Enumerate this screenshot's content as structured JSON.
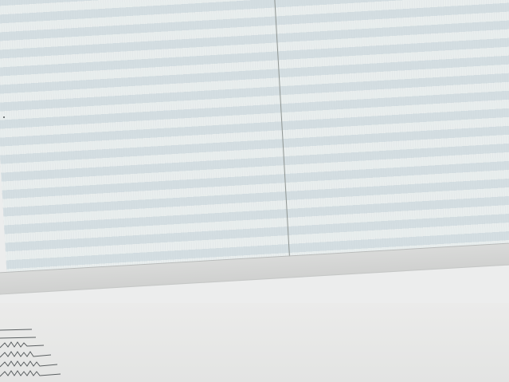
{
  "app": {
    "title": ""
  },
  "table": {
    "columns": [
      "",
      ""
    ],
    "rows": []
  },
  "colors": {
    "row_light": "#e9eeee",
    "row_dark": "#d4dee2",
    "divider": "#8f9592",
    "background": "#eceded"
  },
  "icons": {
    "bottom_left": "zigzag-text-glyph"
  }
}
